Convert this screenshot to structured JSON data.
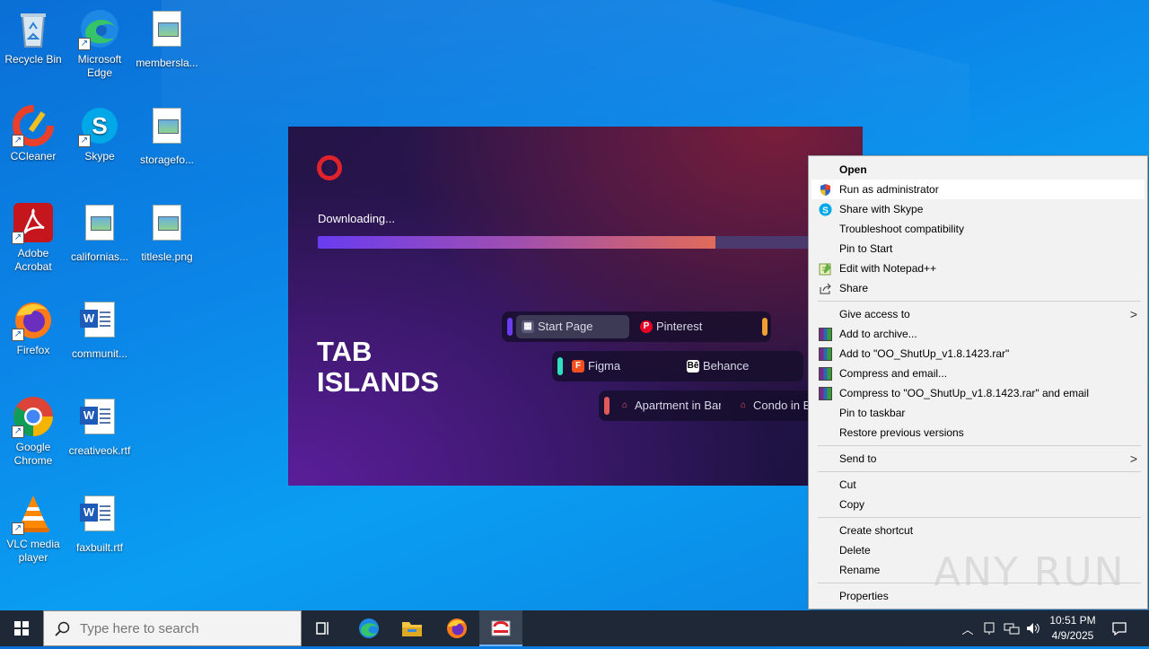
{
  "desktop": {
    "icons": [
      {
        "label": "Recycle Bin",
        "icon": "recycle-bin-icon"
      },
      {
        "label": "Microsoft Edge",
        "icon": "edge-icon"
      },
      {
        "label": "membersla...",
        "icon": "image-file-icon"
      },
      {
        "label": "CCleaner",
        "icon": "ccleaner-icon"
      },
      {
        "label": "Skype",
        "icon": "skype-icon"
      },
      {
        "label": "storagefo...",
        "icon": "image-file-icon"
      },
      {
        "label": "Adobe Acrobat",
        "icon": "acrobat-icon"
      },
      {
        "label": "californias...",
        "icon": "image-file-icon"
      },
      {
        "label": "titlesle.png",
        "icon": "image-file-icon"
      },
      {
        "label": "Firefox",
        "icon": "firefox-icon"
      },
      {
        "label": "communit...",
        "icon": "word-file-icon"
      },
      {
        "label": "Google Chrome",
        "icon": "chrome-icon"
      },
      {
        "label": "creativeok.rtf",
        "icon": "word-file-icon"
      },
      {
        "label": "VLC media player",
        "icon": "vlc-icon"
      },
      {
        "label": "faxbuilt.rtf",
        "icon": "word-file-icon"
      }
    ]
  },
  "installer": {
    "status": "Downloading...",
    "progress": 0.75,
    "title_line1": "TAB",
    "title_line2": "ISLANDS",
    "tabs": [
      "Start Page",
      "Pinterest",
      "Figma",
      "Behance",
      "Apartment in Bar",
      "Condo in B"
    ]
  },
  "context_menu": {
    "open": "Open",
    "run_as_admin": "Run as administrator",
    "share_skype": "Share with Skype",
    "troubleshoot": "Troubleshoot compatibility",
    "pin_start": "Pin to Start",
    "edit_notepad": "Edit with Notepad++",
    "share": "Share",
    "give_access": "Give access to",
    "add_archive": "Add to archive...",
    "add_to_rar": "Add to \"OO_ShutUp_v1.8.1423.rar\"",
    "compress_email": "Compress and email...",
    "compress_rar_email": "Compress to \"OO_ShutUp_v1.8.1423.rar\" and email",
    "pin_taskbar": "Pin to taskbar",
    "restore_prev": "Restore previous versions",
    "send_to": "Send to",
    "cut": "Cut",
    "copy": "Copy",
    "create_shortcut": "Create shortcut",
    "delete": "Delete",
    "rename": "Rename",
    "properties": "Properties"
  },
  "watermark": "ANY RUN",
  "taskbar": {
    "search_placeholder": "Type here to search",
    "time": "10:51 PM",
    "date": "4/9/2025"
  },
  "colors": {
    "desktop": "#0b86e8",
    "taskbar": "#1f2836",
    "menu": "#f2f2f2",
    "progress_start": "#6a3cf0",
    "progress_end": "#e06a5a"
  }
}
